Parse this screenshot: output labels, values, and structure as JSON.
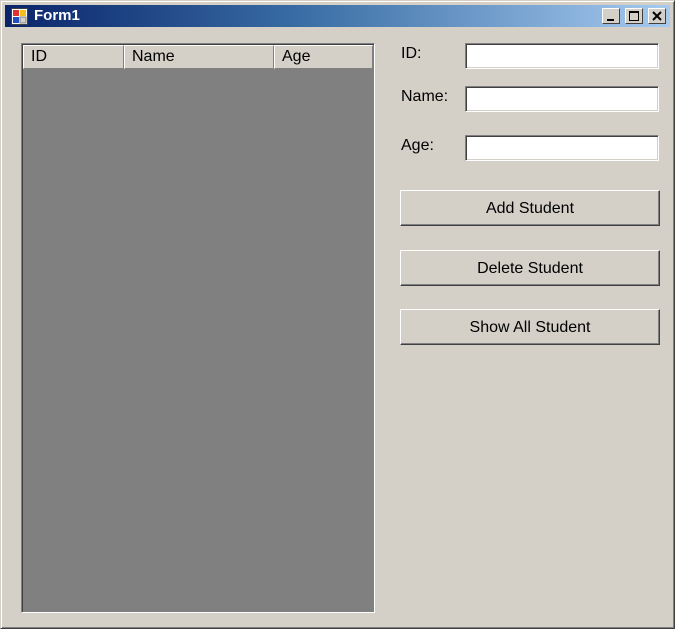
{
  "window": {
    "title": "Form1",
    "icon": "form-app-icon",
    "controls": [
      "minimize-icon",
      "maximize-icon",
      "close-icon"
    ]
  },
  "listview": {
    "columns": [
      "ID",
      "Name",
      "Age"
    ],
    "rows": [],
    "background_color": "#808080"
  },
  "form": {
    "id_label": "ID:",
    "id_value": "",
    "name_label": "Name:",
    "name_value": "",
    "age_label": "Age:",
    "age_value": ""
  },
  "buttons": {
    "add_label": "Add Student",
    "delete_label": "Delete Student",
    "show_all_label": "Show All Student"
  },
  "colors": {
    "face": "#d4d0c8",
    "title_start": "#0a246a",
    "title_end": "#a6caf0"
  }
}
